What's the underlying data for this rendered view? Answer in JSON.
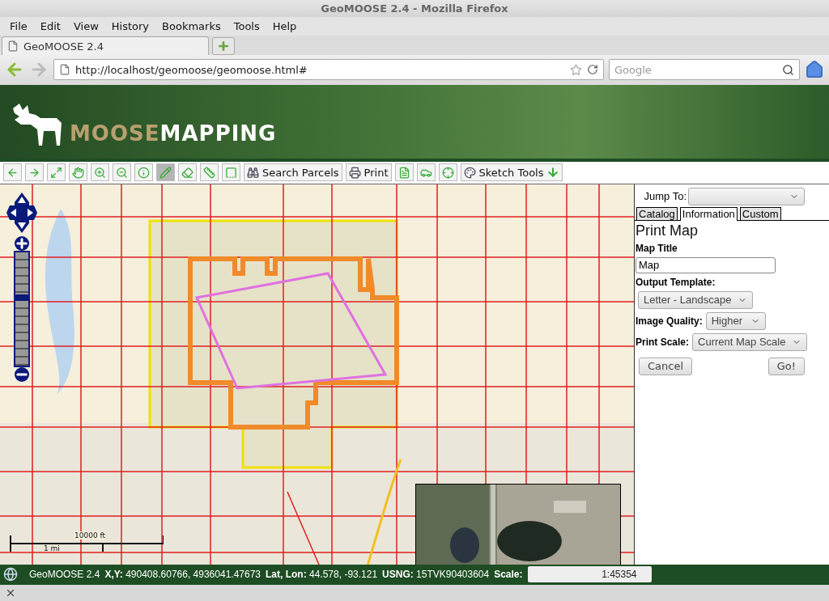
{
  "window": {
    "title": "GeoMOOSE 2.4 - Mozilla Firefox"
  },
  "menu": [
    "File",
    "Edit",
    "View",
    "History",
    "Bookmarks",
    "Tools",
    "Help"
  ],
  "browser_tabs": [
    {
      "label": "GeoMOOSE 2.4",
      "selected": true
    }
  ],
  "address_bar": {
    "value": "http://localhost/geomoose/geomoose.html#"
  },
  "search": {
    "placeholder": "Google"
  },
  "banner": {
    "logo_first": "MOOSE",
    "logo_second": "MAPPING"
  },
  "toolbar": [
    {
      "kind": "tool",
      "selected": false
    },
    {
      "kind": "tool",
      "selected": false
    },
    {
      "kind": "tool",
      "selected": false
    },
    {
      "kind": "tool",
      "selected": false
    },
    {
      "kind": "tool",
      "selected": false
    },
    {
      "kind": "tool",
      "selected": false
    },
    {
      "kind": "tool",
      "selected": false
    },
    {
      "kind": "tool",
      "selected": true
    },
    {
      "kind": "tool",
      "selected": false
    },
    {
      "kind": "tool",
      "selected": false
    },
    {
      "kind": "tool",
      "selected": false
    },
    {
      "kind": "button",
      "label": "Search Parcels"
    },
    {
      "kind": "button",
      "label": "Print"
    },
    {
      "kind": "tool",
      "selected": false
    },
    {
      "kind": "tool",
      "selected": false
    },
    {
      "kind": "tool",
      "selected": false
    },
    {
      "kind": "button",
      "label": "Sketch Tools"
    }
  ],
  "map": {
    "zoom_slider": {
      "level": 0.6
    },
    "scale_bar": {
      "top_label": "10000 ft",
      "bottom_label": "1 mi"
    }
  },
  "panel": {
    "jump_to": {
      "label": "Jump To:"
    },
    "tabs": [
      {
        "label": "Catalog",
        "selected": false
      },
      {
        "label": "Information",
        "selected": true
      },
      {
        "label": "Custom",
        "selected": false
      }
    ],
    "title": "Print Map",
    "fields": [
      {
        "kind": "text",
        "label": "Map Title",
        "value": "Map"
      },
      {
        "kind": "select",
        "label": "Output Template:",
        "value": "Letter - Landscape"
      },
      {
        "kind": "select",
        "label": "Image Quality:",
        "value": "Higher"
      },
      {
        "kind": "select",
        "label": "Print Scale:",
        "value": "Current Map Scale"
      }
    ],
    "buttons": [
      "Cancel",
      "Go!"
    ]
  },
  "status_bar": {
    "app": "GeoMOOSE 2.4",
    "readouts": [
      {
        "label": "X,Y:",
        "value": "490408.60766, 4936041.47673"
      },
      {
        "label": "Lat, Lon:",
        "value": "44.578, -93.121"
      },
      {
        "label": "USNG:",
        "value": "15TVK90403604"
      }
    ],
    "scale_label": "Scale:",
    "scale_value": "1:45354"
  }
}
